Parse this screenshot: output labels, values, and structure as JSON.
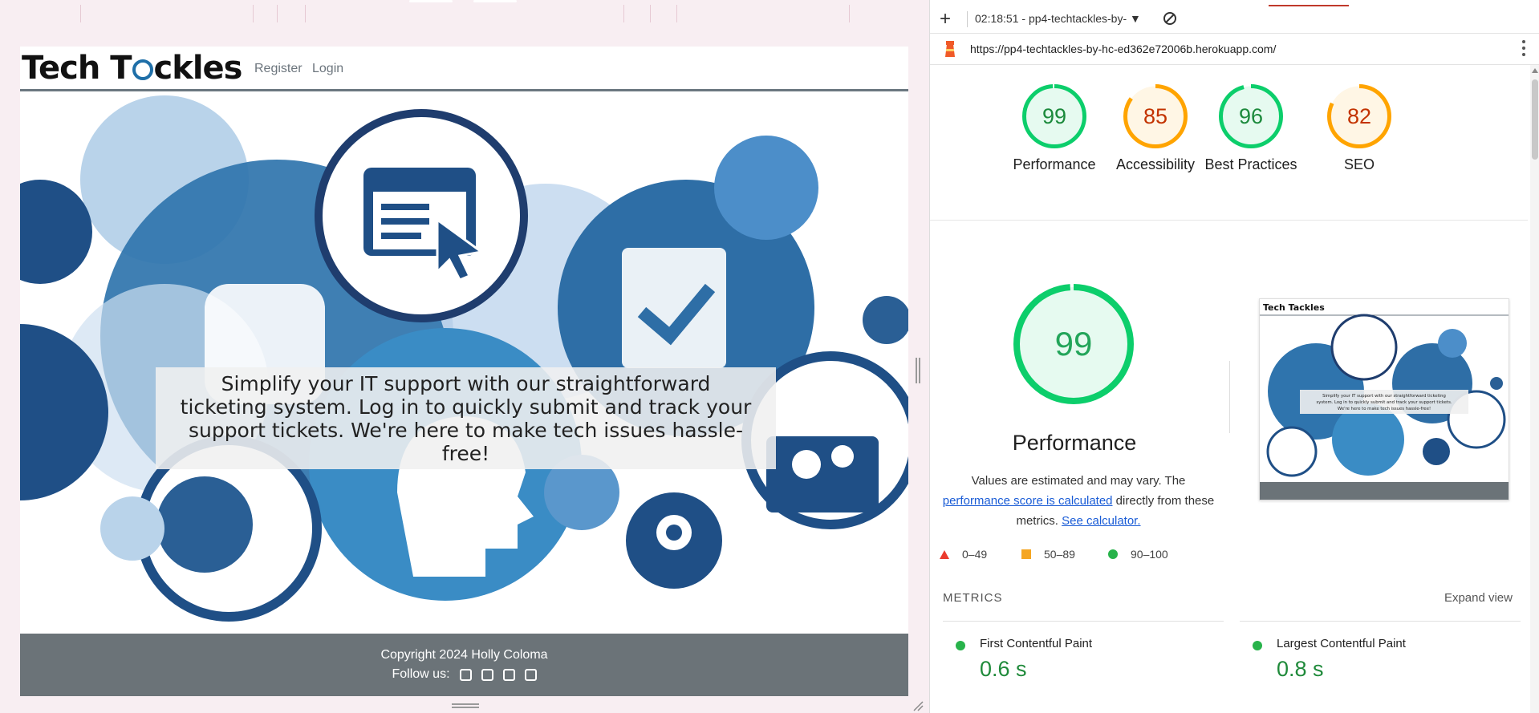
{
  "site": {
    "logo": "Tech Tackles",
    "logo_parts": [
      "Tech T",
      "ckles"
    ],
    "nav": [
      "Register",
      "Login"
    ],
    "hero_text": "Simplify your IT support with our straightforward ticketing system. Log in to quickly submit and track your support tickets. We're here to make tech issues hassle-free!",
    "footer": {
      "copyright": "Copyright 2024 Holly Coloma",
      "follow_label": "Follow us:",
      "social_icons": [
        "facebook-icon",
        "twitter-icon",
        "instagram-icon",
        "youtube-icon"
      ]
    }
  },
  "devtools": {
    "toolbar": {
      "add_icon": "plus-icon",
      "report_label": "02:18:51 - pp4-techtackles-by-",
      "clear_icon": "clear-icon"
    },
    "url": "https://pp4-techtackles-by-hc-ed362e72006b.herokuapp.com/",
    "scores": [
      {
        "value": "99",
        "label": "Performance",
        "color": "#0cce6b",
        "text_color": "#1c8a3c",
        "fraction": 0.99
      },
      {
        "value": "85",
        "label": "Accessibility",
        "color": "#ffa400",
        "text_color": "#c33300",
        "fraction": 0.85
      },
      {
        "value": "96",
        "label": "Best Practices",
        "color": "#0cce6b",
        "text_color": "#1c8a3c",
        "fraction": 0.96
      },
      {
        "value": "82",
        "label": "SEO",
        "color": "#ffa400",
        "text_color": "#c33300",
        "fraction": 0.82
      }
    ],
    "performance": {
      "score": "99",
      "fraction": 0.99,
      "title": "Performance",
      "note_pre": "Values are estimated and may vary. The ",
      "note_link1": "performance score is calculated",
      "note_mid": " directly from these metrics. ",
      "note_link2": "See calculator."
    },
    "legend": [
      "0–49",
      "50–89",
      "90–100"
    ],
    "metrics_header": "METRICS",
    "expand_label": "Expand view",
    "metrics": [
      {
        "name": "First Contentful Paint",
        "value": "0.6 s"
      },
      {
        "name": "Largest Contentful Paint",
        "value": "0.8 s"
      }
    ],
    "thumbnail": {
      "logo": "Tech Tackles",
      "hero_text": "Simplify your IT support with our straightforward ticketing system. Log in to quickly submit and track your support tickets. We're here to make tech issues hassle-free!"
    }
  }
}
